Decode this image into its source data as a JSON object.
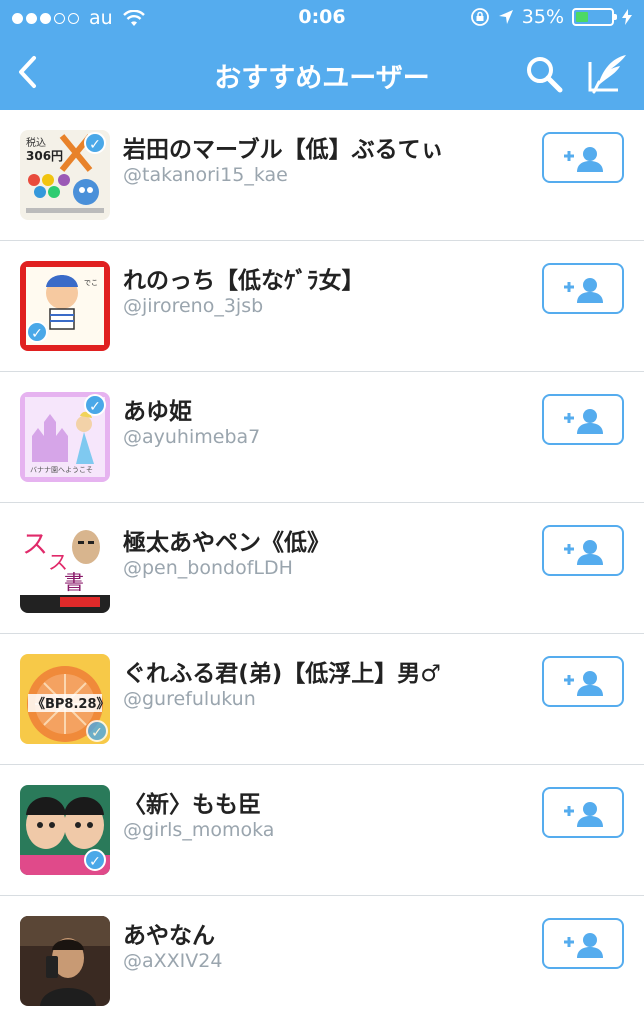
{
  "status_bar": {
    "carrier": "au",
    "time": "0:06",
    "battery": "35%"
  },
  "nav": {
    "title": "おすすめユーザー"
  },
  "users": [
    {
      "name": "岩田のマーブル【低】ぶるてぃ",
      "handle": "@takanori15_kae"
    },
    {
      "name": "れのっち【低なｹﾞﾗ女】",
      "handle": "@jiroreno_3jsb"
    },
    {
      "name": "あゆ姫",
      "handle": "@ayuhimeba7"
    },
    {
      "name": "極太あやペン《低》",
      "handle": "@pen_bondofLDH"
    },
    {
      "name": "ぐれふる君(弟)【低浮上】男♂",
      "handle": "@gurefulukun"
    },
    {
      "name": "〈新〉もも臣",
      "handle": "@girls_momoka"
    },
    {
      "name": "あやなん",
      "handle": "@aXXIV24"
    }
  ],
  "colors": {
    "accent": "#55acee",
    "battery": "#4cd964",
    "verified": "#4aa8e8"
  },
  "icons": [
    "back-icon",
    "search-icon",
    "compose-icon",
    "follow-icon",
    "verified-icon",
    "wifi-icon",
    "location-icon",
    "lock-rotation-icon",
    "battery-icon"
  ]
}
